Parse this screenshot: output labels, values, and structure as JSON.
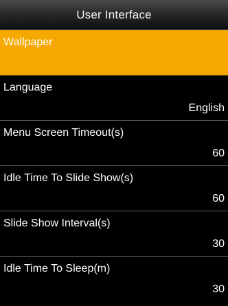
{
  "header": {
    "title": "User Interface"
  },
  "colors": {
    "selected_background": "#f5a800",
    "background": "#000000",
    "text": "#ffffff"
  },
  "menu": {
    "items": [
      {
        "label": "Wallpaper",
        "value": ""
      },
      {
        "label": "Language",
        "value": "English"
      },
      {
        "label": "Menu Screen Timeout(s)",
        "value": "60"
      },
      {
        "label": "Idle Time To Slide Show(s)",
        "value": "60"
      },
      {
        "label": "Slide Show Interval(s)",
        "value": "30"
      },
      {
        "label": "Idle Time To Sleep(m)",
        "value": "30"
      }
    ]
  }
}
